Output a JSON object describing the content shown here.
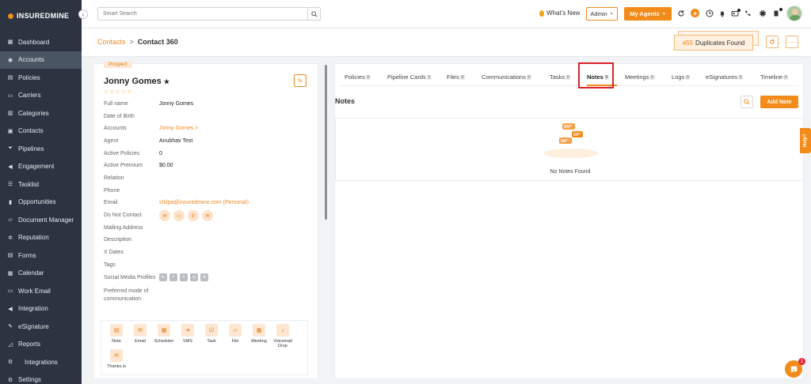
{
  "sidebar": {
    "logo": "INSUREDMINE",
    "items": [
      {
        "label": "Dashboard",
        "icon": "dashboard-icon"
      },
      {
        "label": "Accounts",
        "icon": "accounts-icon",
        "active": true
      },
      {
        "label": "Policies",
        "icon": "policies-icon"
      },
      {
        "label": "Carriers",
        "icon": "carriers-icon"
      },
      {
        "label": "Categories",
        "icon": "categories-icon"
      },
      {
        "label": "Contacts",
        "icon": "contacts-icon"
      },
      {
        "label": "Pipelines",
        "icon": "pipelines-icon"
      },
      {
        "label": "Engagement",
        "icon": "engagement-icon"
      },
      {
        "label": "Tasklist",
        "icon": "tasklist-icon"
      },
      {
        "label": "Opportunities",
        "icon": "opportunities-icon"
      },
      {
        "label": "Document Manager",
        "icon": "folder-icon"
      },
      {
        "label": "Reputation",
        "icon": "reputation-icon"
      },
      {
        "label": "Forms",
        "icon": "forms-icon"
      },
      {
        "label": "Calendar",
        "icon": "calendar-icon"
      },
      {
        "label": "Work Email",
        "icon": "email-icon"
      },
      {
        "label": "Integration",
        "icon": "integration-icon"
      },
      {
        "label": "eSignature",
        "icon": "esignature-icon"
      },
      {
        "label": "Reports",
        "icon": "reports-icon"
      },
      {
        "label": "Integrations",
        "icon": "integrations-icon"
      },
      {
        "label": "Settings",
        "icon": "settings-icon"
      }
    ]
  },
  "topbar": {
    "search_placeholder": "Smart Search",
    "whats_new": "What's New",
    "admin_select": "Admin",
    "my_agents": "My Agents"
  },
  "header": {
    "breadcrumb_parent": "Contacts",
    "breadcrumb_sep": ">",
    "breadcrumb_current": "Contact 360",
    "duplicates_count": "#55",
    "duplicates_label": "Duplicates Found"
  },
  "contact": {
    "badge": "Prospect",
    "name": "Jonny Gomes",
    "fields": [
      {
        "label": "Full name",
        "value": "Jonny Gomes"
      },
      {
        "label": "Date of Birth",
        "value": ""
      },
      {
        "label": "Accounts",
        "value": "Jonny Gomes >",
        "link": true
      },
      {
        "label": "Agent",
        "value": "Anubhav Test"
      },
      {
        "label": "Active Policies",
        "value": "0"
      },
      {
        "label": "Active Premium",
        "value": "$0.00"
      },
      {
        "label": "Relation",
        "value": ""
      },
      {
        "label": "Phone",
        "value": ""
      },
      {
        "label": "Email",
        "value": "shilpa@insuredmine.com  (Personal)",
        "link": true
      },
      {
        "label": "Do Not Contact",
        "value": ""
      },
      {
        "label": "Mailing Address",
        "value": ""
      },
      {
        "label": "Description",
        "value": ""
      },
      {
        "label": "X Dates",
        "value": ""
      },
      {
        "label": "Tags",
        "value": ""
      },
      {
        "label": "Social Media Profiles",
        "value": ""
      },
      {
        "label": "Preferred mode of communication",
        "value": ""
      }
    ],
    "actions": [
      "Note",
      "Email",
      "Scheduler",
      "SMS",
      "Task",
      "File",
      "Meeting",
      "Voicemail Drop",
      "Thanks.io"
    ]
  },
  "tabs": [
    {
      "label": "Policies",
      "count": "0"
    },
    {
      "label": "Pipeline Cards",
      "count": "1"
    },
    {
      "label": "Files",
      "count": "0"
    },
    {
      "label": "Communications",
      "count": "0"
    },
    {
      "label": "Tasks",
      "count": "0"
    },
    {
      "label": "Notes",
      "count": "0",
      "active": true
    },
    {
      "label": "Meetings",
      "count": "0"
    },
    {
      "label": "Logs",
      "count": "0"
    },
    {
      "label": "eSignatures",
      "count": "0"
    },
    {
      "label": "Timeline",
      "count": "0"
    }
  ],
  "notes": {
    "title": "Notes",
    "add_button": "Add Note",
    "empty_text": "No Notes Found"
  },
  "help_tab": "Help",
  "chat_badge": "1",
  "colors": {
    "accent": "#f28b1a",
    "sidebar": "#2b3440",
    "highlight": "#d8232a"
  }
}
